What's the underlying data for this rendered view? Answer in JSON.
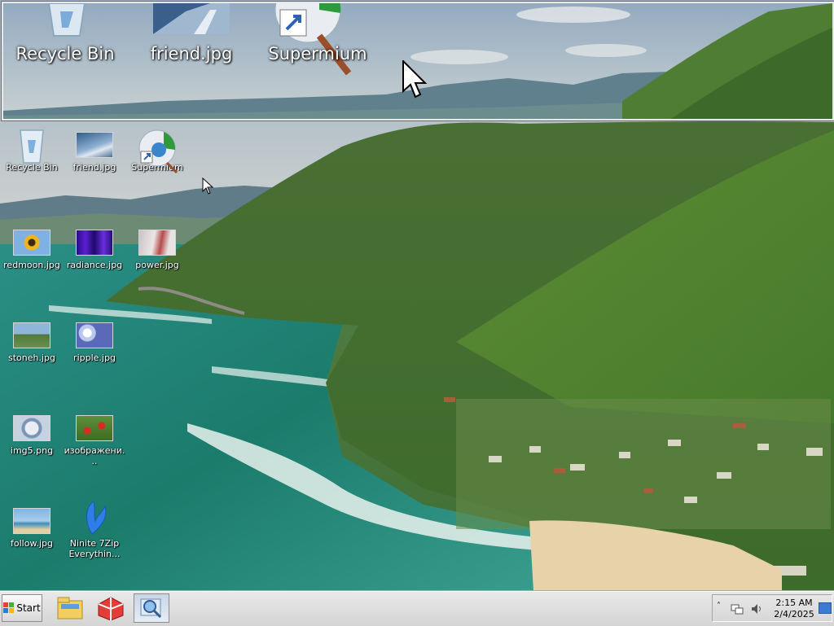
{
  "magnifier": {
    "labels": [
      "Recycle Bin",
      "friend.jpg",
      "Supermium"
    ]
  },
  "desktop": {
    "icons": [
      {
        "label": "Recycle Bin",
        "icon": "recycle-bin-icon"
      },
      {
        "label": "friend.jpg",
        "icon": "image-file-icon"
      },
      {
        "label": "Supermium",
        "icon": "supermium-browser-icon"
      },
      {
        "label": "redmoon.jpg",
        "icon": "image-file-icon"
      },
      {
        "label": "radiance.jpg",
        "icon": "image-file-icon"
      },
      {
        "label": "power.jpg",
        "icon": "image-file-icon"
      },
      {
        "label": "stoneh.jpg",
        "icon": "image-file-icon"
      },
      {
        "label": "ripple.jpg",
        "icon": "image-file-icon"
      },
      {
        "label": "img5.png",
        "icon": "image-file-icon"
      },
      {
        "label": "изображени...",
        "icon": "image-file-icon"
      },
      {
        "label": "follow.jpg",
        "icon": "image-file-icon"
      },
      {
        "label": "Ninite 7Zip Everythin...",
        "icon": "ninite-installer-icon"
      }
    ]
  },
  "taskbar": {
    "start_label": "Start",
    "pinned": [
      {
        "name": "file-explorer-icon"
      },
      {
        "name": "app-cube-icon"
      },
      {
        "name": "magnifier-icon",
        "active": true
      }
    ],
    "tray": {
      "time": "2:15 AM",
      "date": "2/4/2025"
    }
  },
  "colors": {
    "taskbar_bg": "#d9d9d9",
    "sea": "#1f8a7e",
    "hills": "#4b7a35"
  }
}
